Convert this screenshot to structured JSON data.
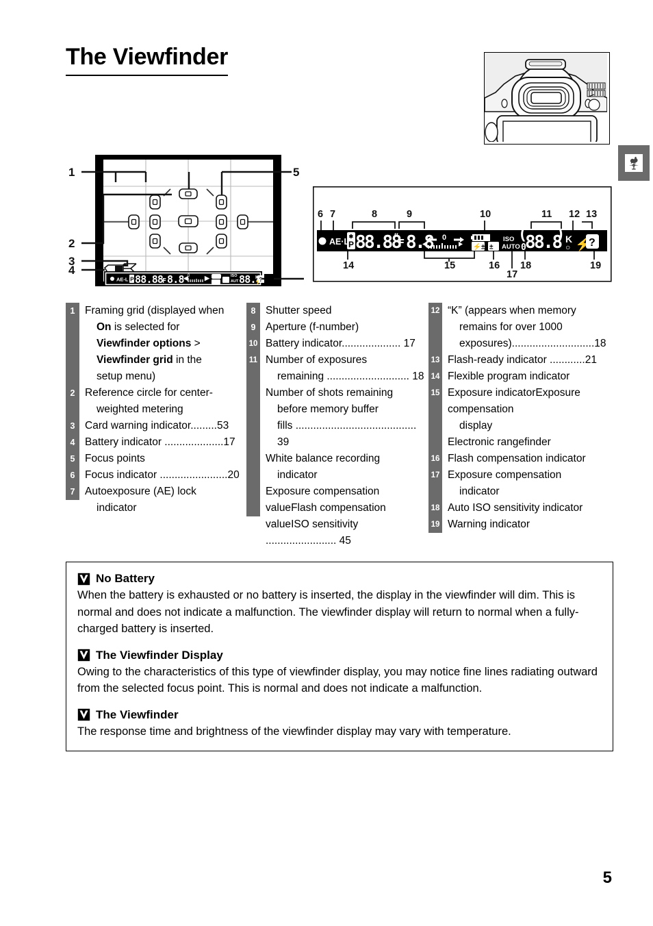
{
  "page_title": "The Viewfinder",
  "page_number": "5",
  "side_tab": {
    "icon": "weathervane-rooster-icon"
  },
  "camera_figure": {
    "alt": "camera-viewfinder-eyepiece-photo"
  },
  "viewfinder_diagram": {
    "callouts": [
      "1",
      "2",
      "3",
      "4",
      "5"
    ],
    "display_strip": "● AE-L P 88.88\" F8.8 ◄|||||0|||||► ⚡± ± ISO AUTO 888 K ⚡ ?"
  },
  "detail_panel": {
    "top_labels": [
      "6",
      "7",
      "8",
      "9",
      "10",
      "11",
      "12",
      "13"
    ],
    "bottom_labels": [
      "14",
      "15",
      "16",
      "17",
      "18",
      "19"
    ],
    "segments": {
      "focus_indicator": "●",
      "ae_lock": "AE-L",
      "flexible_program": "P",
      "shutter_speed": "88.88\"",
      "aperture_prefix": "F",
      "aperture": "8.8",
      "exposure_zero": "0",
      "flash_comp": "⚡±",
      "exposure_comp": "±",
      "iso_label": "ISO",
      "auto_label": "AUTO",
      "exposures": "88.8",
      "k_label": "K",
      "flash_ready": "⚡",
      "warning": "?"
    }
  },
  "legend": {
    "col1": [
      {
        "num": "1",
        "lines": [
          {
            "text": "Framing grid (displayed when",
            "indent": false
          },
          {
            "text": "On is selected for",
            "indent": true,
            "bold_prefix": "On"
          },
          {
            "text": "Viewfinder options >",
            "indent": true,
            "bold_prefix": "Viewfinder options"
          },
          {
            "text": "Viewfinder grid in the",
            "indent": true,
            "bold_prefix": "Viewfinder grid"
          },
          {
            "text": "setup menu)",
            "indent": true
          }
        ]
      },
      {
        "num": "2",
        "lines": [
          {
            "text": "Reference circle for center-",
            "indent": false
          },
          {
            "text": "weighted metering",
            "indent": true
          }
        ]
      },
      {
        "num": "3",
        "lines": [
          {
            "text": "Card warning indicator.........53",
            "indent": false
          }
        ]
      },
      {
        "num": "4",
        "lines": [
          {
            "text": "Battery indicator ....................17",
            "indent": false
          }
        ]
      },
      {
        "num": "5",
        "lines": [
          {
            "text": "Focus points",
            "indent": false
          }
        ]
      },
      {
        "num": "6",
        "lines": [
          {
            "text": "Focus indicator .......................20",
            "indent": false
          }
        ]
      },
      {
        "num": "7",
        "lines": [
          {
            "text": "Autoexposure (AE) lock",
            "indent": false
          },
          {
            "text": "indicator",
            "indent": true
          }
        ]
      }
    ],
    "col2": [
      {
        "num": "8",
        "lines": [
          {
            "text": "Shutter speed",
            "indent": false
          }
        ]
      },
      {
        "num": "9",
        "lines": [
          {
            "text": "Aperture (f-number)",
            "indent": false
          }
        ]
      },
      {
        "num": "10",
        "lines": [
          {
            "text": "Battery indicator.................... 17",
            "indent": false
          }
        ]
      },
      {
        "num": "11",
        "lines": [
          {
            "text": "Number of exposures",
            "indent": false
          },
          {
            "text": "remaining ............................ 18",
            "indent": true
          },
          {
            "text": "Number of shots remaining",
            "indent": false
          },
          {
            "text": "before memory buffer",
            "indent": true
          },
          {
            "text": "fills ......................................... 39",
            "indent": true
          },
          {
            "text": "White balance recording",
            "indent": false
          },
          {
            "text": "indicator",
            "indent": true
          },
          {
            "text": "Exposure compensation value",
            "indent": false
          },
          {
            "text": "Flash compensation value",
            "indent": false
          },
          {
            "text": "ISO sensitivity ........................ 45",
            "indent": false
          }
        ]
      }
    ],
    "col3": [
      {
        "num": "12",
        "lines": [
          {
            "text": "“K” (appears when memory",
            "indent": false
          },
          {
            "text": "remains for over 1000",
            "indent": true
          },
          {
            "text": "exposures)............................18",
            "indent": true
          }
        ]
      },
      {
        "num": "13",
        "lines": [
          {
            "text": "Flash-ready indicator ............21",
            "indent": false
          }
        ]
      },
      {
        "num": "14",
        "lines": [
          {
            "text": "Flexible program indicator",
            "indent": false
          }
        ]
      },
      {
        "num": "15",
        "lines": [
          {
            "text": "Exposure indicator",
            "indent": false
          },
          {
            "text": "Exposure compensation",
            "indent": false
          },
          {
            "text": "display",
            "indent": true
          },
          {
            "text": "Electronic rangefinder",
            "indent": false
          }
        ]
      },
      {
        "num": "16",
        "lines": [
          {
            "text": "Flash compensation indicator",
            "indent": false
          }
        ]
      },
      {
        "num": "17",
        "lines": [
          {
            "text": "Exposure compensation",
            "indent": false
          },
          {
            "text": "indicator",
            "indent": true
          }
        ]
      },
      {
        "num": "18",
        "lines": [
          {
            "text": "Auto ISO sensitivity indicator",
            "indent": false
          }
        ]
      },
      {
        "num": "19",
        "lines": [
          {
            "text": "Warning indicator",
            "indent": false
          }
        ]
      }
    ]
  },
  "notes": [
    {
      "heading": "No Battery",
      "body": "When the battery is exhausted or no battery is inserted, the display in the viewfinder will dim.  This is normal and does not indicate a malfunction.  The viewfinder display will return to normal when a fully-charged battery is inserted."
    },
    {
      "heading": "The Viewfinder Display",
      "body": "Owing to the characteristics of this type of viewfinder display, you may notice fine lines radiating outward from the selected focus point. This is normal and does not indicate a malfunction."
    },
    {
      "heading": "The Viewfinder",
      "body": "The response time and brightness of the viewfinder display may vary with temperature."
    }
  ]
}
